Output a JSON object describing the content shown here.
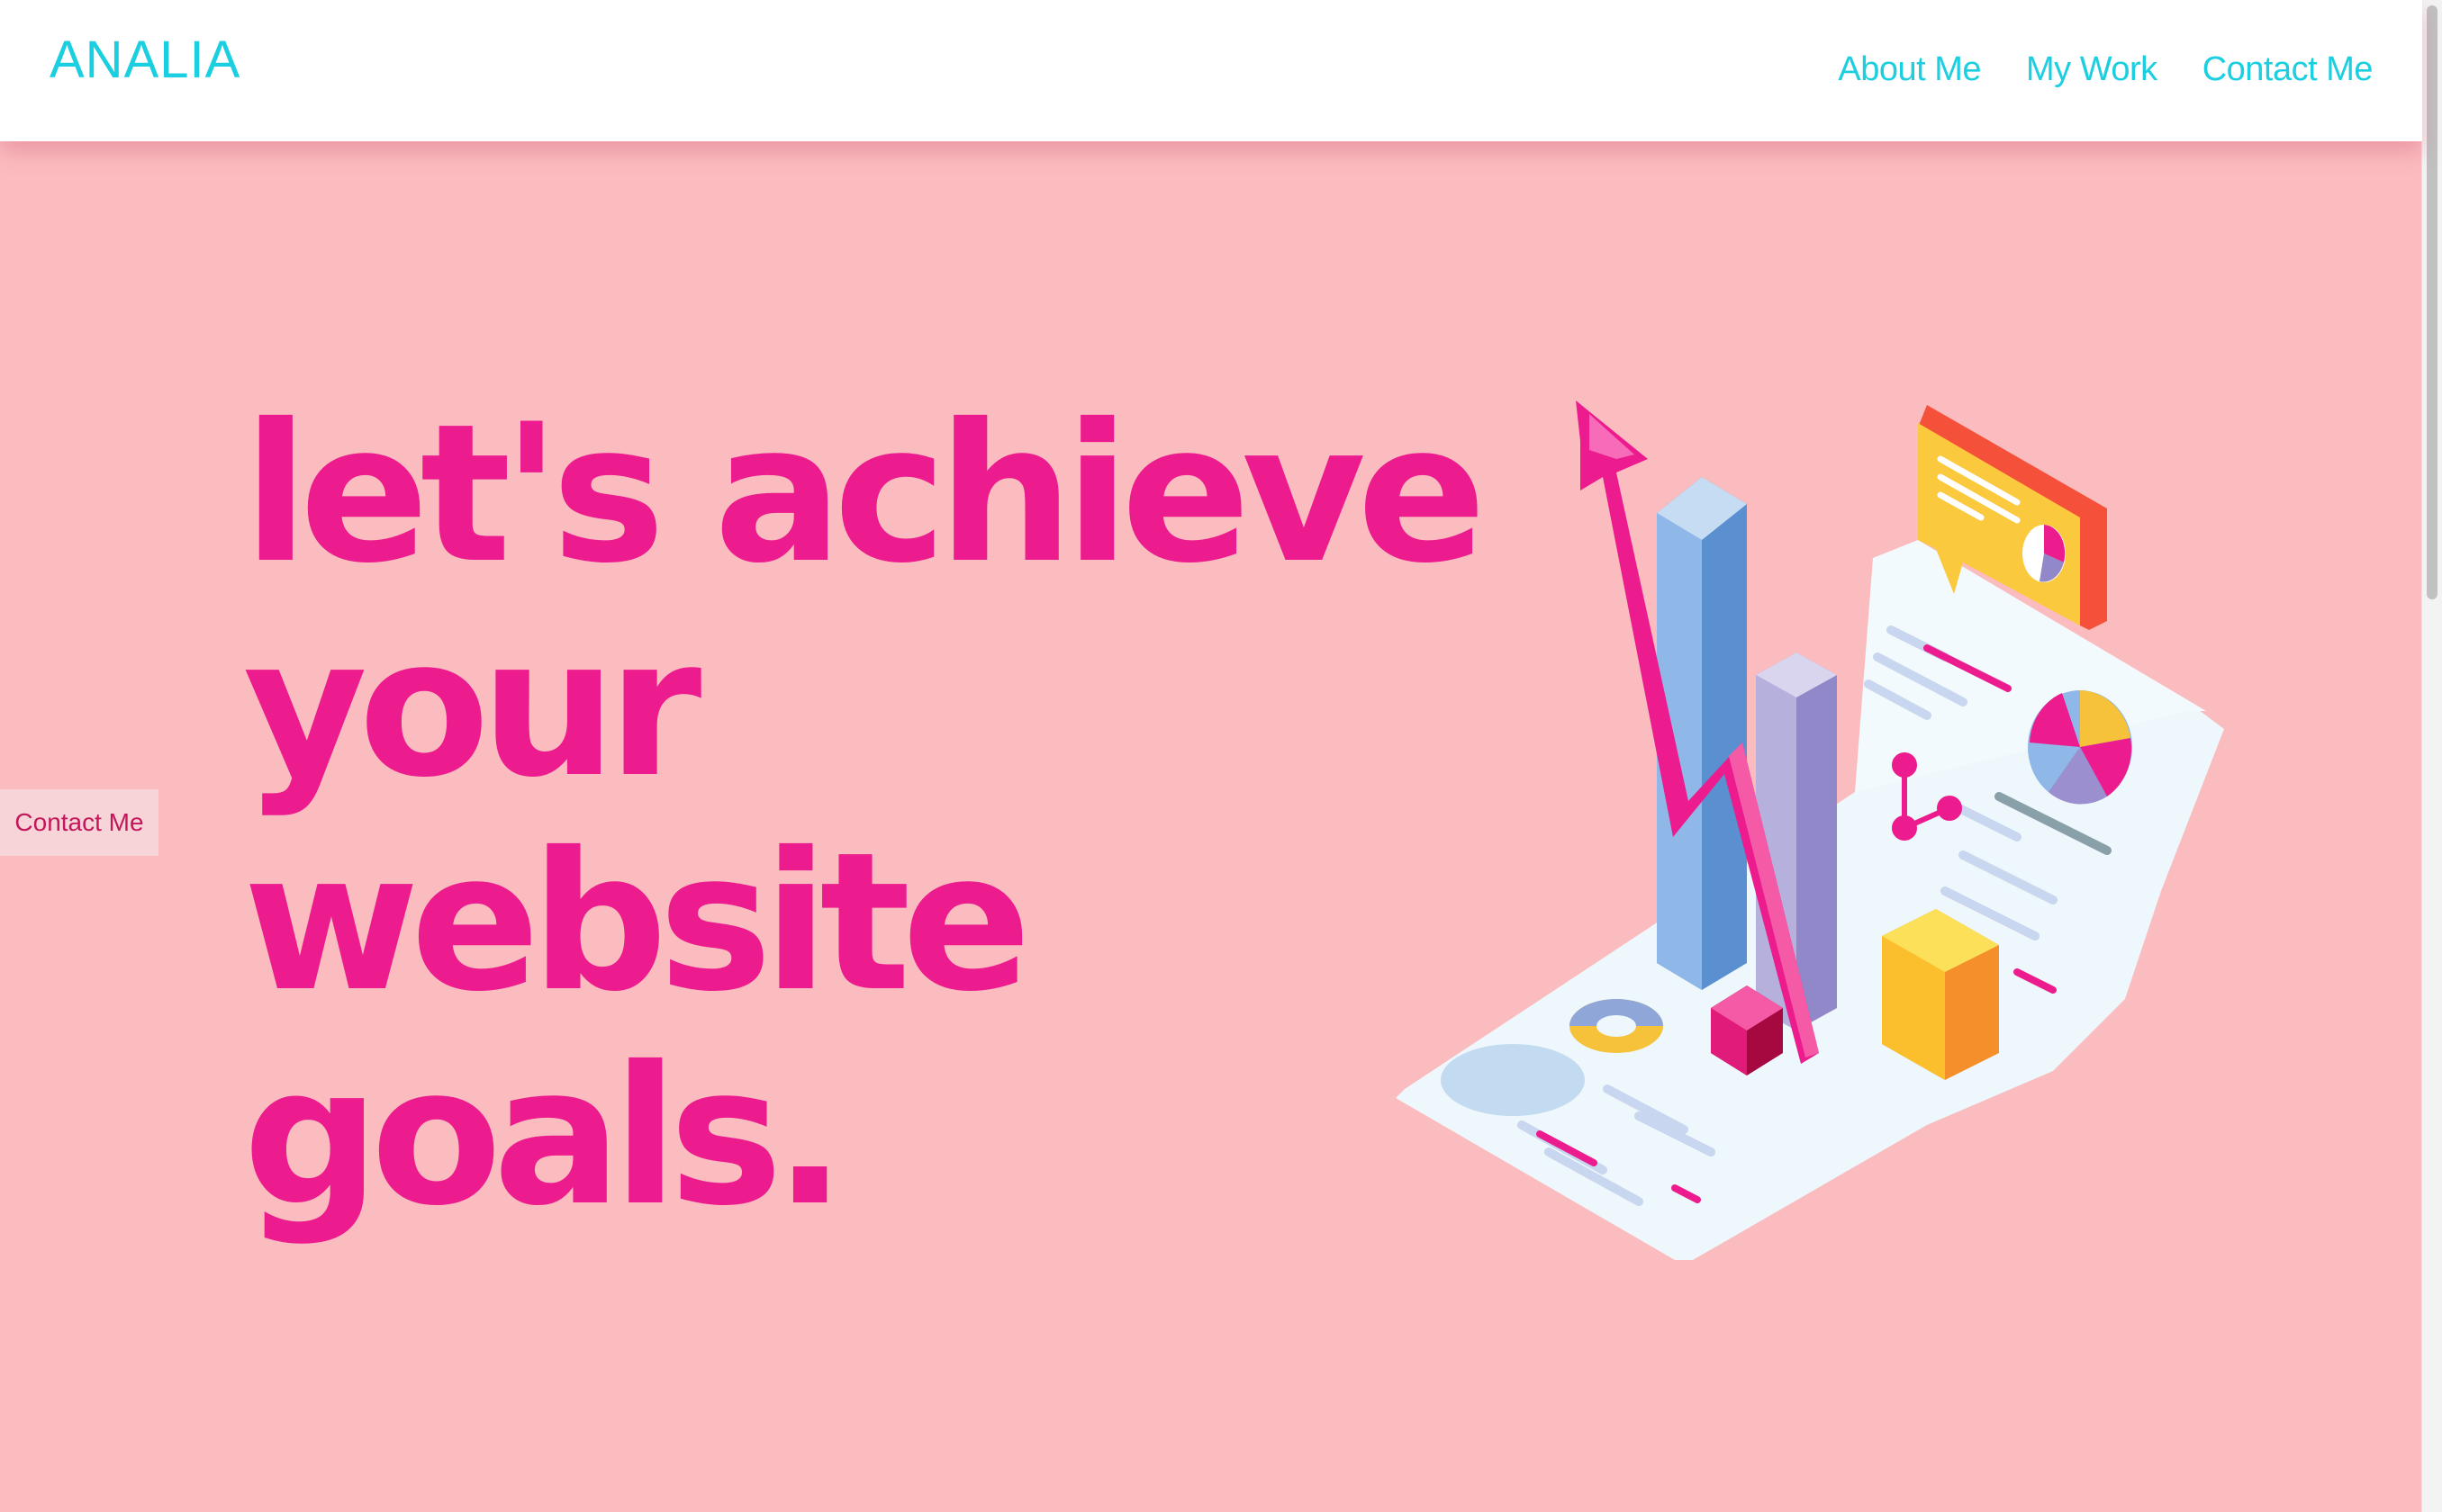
{
  "navbar": {
    "brand": "ANALIA",
    "links": [
      {
        "label": "About Me"
      },
      {
        "label": "My Work"
      },
      {
        "label": "Contact Me"
      }
    ]
  },
  "hero": {
    "heading_lines": [
      "let's achieve",
      "your website",
      "goals."
    ]
  },
  "side_tab": {
    "label": "Contact Me"
  },
  "illustration": {
    "icon": "growth-analytics-illustration"
  },
  "colors": {
    "brand": "#1ccfe0",
    "heading": "#ec1c8e",
    "background": "#fbbcbf",
    "navbar": "#ffffff",
    "side_tab_bg": "#f6d4d8"
  }
}
